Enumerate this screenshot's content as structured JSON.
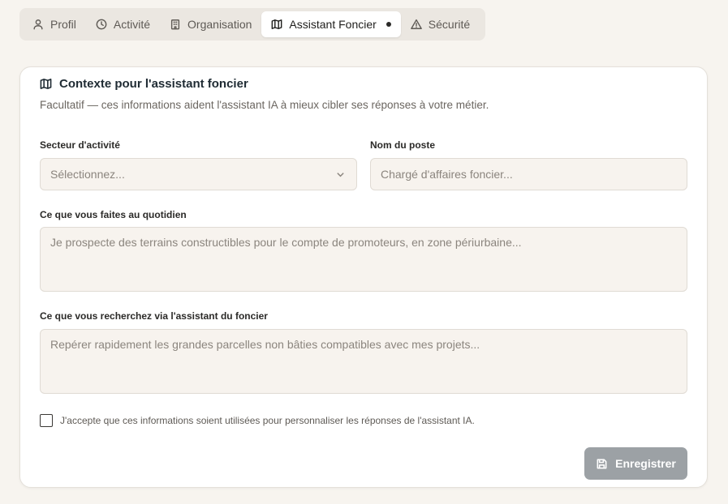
{
  "tabs": [
    {
      "label": "Profil",
      "icon": "user-icon",
      "active": false
    },
    {
      "label": "Activité",
      "icon": "clock-icon",
      "active": false
    },
    {
      "label": "Organisation",
      "icon": "building-icon",
      "active": false
    },
    {
      "label": "Assistant Foncier",
      "icon": "map-icon",
      "active": true
    },
    {
      "label": "Sécurité",
      "icon": "warning-icon",
      "active": false
    }
  ],
  "card": {
    "title": "Contexte pour l'assistant foncier",
    "subtitle": "Facultatif — ces informations aident l'assistant IA à mieux cibler ses réponses à votre métier."
  },
  "form": {
    "sector": {
      "label": "Secteur d'activité",
      "placeholder": "Sélectionnez..."
    },
    "job_title": {
      "label": "Nom du poste",
      "placeholder": "Chargé d'affaires foncier..."
    },
    "daily": {
      "label": "Ce que vous faites au quotidien",
      "placeholder": "Je prospecte des terrains constructibles pour le compte de promoteurs, en zone périurbaine..."
    },
    "search": {
      "label": "Ce que vous recherchez via l'assistant du foncier",
      "placeholder": "Repérer rapidement les grandes parcelles non bâties compatibles avec mes projets..."
    },
    "consent": "J'accepte que ces informations soient utilisées pour personnaliser les réponses de l'assistant IA.",
    "save_label": "Enregistrer"
  },
  "colors": {
    "background": "#f7f4ef",
    "save_button": "#9ca1a5"
  }
}
